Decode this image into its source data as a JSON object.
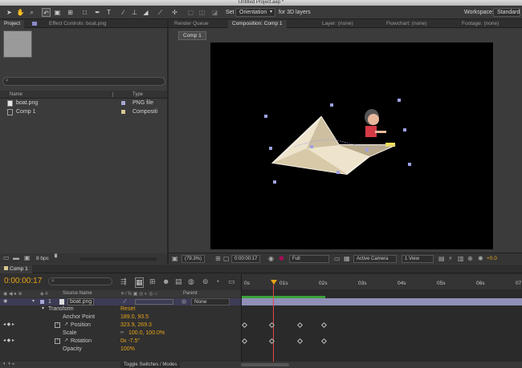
{
  "window": {
    "title": "Untitled Project.aep *"
  },
  "toolbar": {
    "set_label": "Set",
    "orientation_value": "Orientation",
    "for3d_label": "for 3D layers",
    "workspace_label": "Workspace:",
    "workspace_value": "Standard"
  },
  "left_panel": {
    "tabs": [
      "Project",
      "Effect Controls: boat.png"
    ],
    "columns": [
      "Name",
      "Type"
    ],
    "items": [
      {
        "name": "boat.png",
        "type": "PNG file",
        "color": "#a8a8d8"
      },
      {
        "name": "Comp 1",
        "type": "Compositi",
        "color": "#d8c890"
      }
    ],
    "bpc": "8 bpc"
  },
  "viewer": {
    "tabs": [
      "Render Queue",
      "Composition: Comp 1",
      "Layer: (none)",
      "Flowchart: (none)",
      "Footage: (none)"
    ],
    "comp_button": "Comp 1",
    "zoom": "(79.3%)",
    "timecode": "0:00:00:17",
    "resolution": "Full",
    "camera": "Active Camera",
    "view": "1 View",
    "exposure": "+0.0"
  },
  "timeline": {
    "tab": "Comp 1",
    "time": "0:00:00:17",
    "columns": {
      "source_name": "Source Name",
      "parent": "Parent"
    },
    "ruler": [
      "0s",
      "01s",
      "02s",
      "03s",
      "04s",
      "05s",
      "06s",
      "07"
    ],
    "layer": {
      "num": "1",
      "name": "boat.png",
      "parent": "None"
    },
    "transform_label": "Transform",
    "reset_label": "Reset",
    "props": [
      {
        "name": "Anchor Point",
        "value": "189.0, 93.5"
      },
      {
        "name": "Position",
        "value": "323.9, 269.3"
      },
      {
        "name": "Scale",
        "value": "100.0, 100.0%"
      },
      {
        "name": "Rotation",
        "value": "0x -7.5°"
      },
      {
        "name": "Opacity",
        "value": "100%"
      }
    ],
    "toggle_label": "Toggle Switches / Modes"
  },
  "colors": {
    "accent": "#e7a418",
    "timeline_bar": "#9090c0",
    "work_area": "#3aa03a"
  }
}
